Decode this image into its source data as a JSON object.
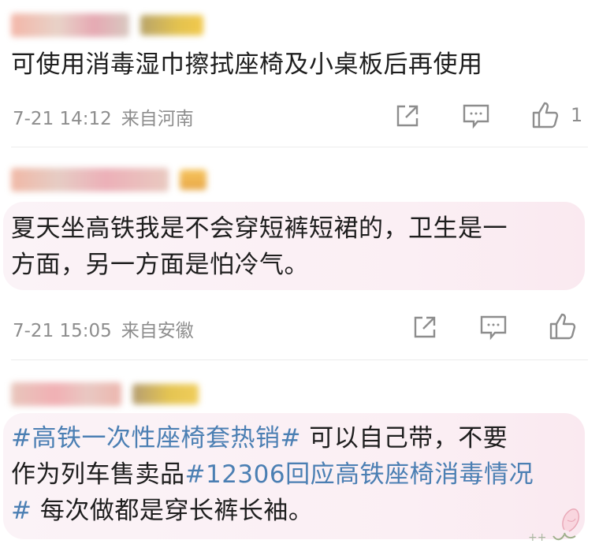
{
  "comments": [
    {
      "text": "可使用消毒湿巾擦拭座椅及小桌板后再使用",
      "date": "7-21 14:12",
      "location": "来自河南",
      "like_count": "1"
    },
    {
      "text_line1": "夏天坐高铁我是不会穿短裤短裙的，卫生是一",
      "text_line2": "方面，另一方面是怕冷气。",
      "date": "7-21 15:05",
      "location": "来自安徽",
      "like_count": ""
    },
    {
      "hashtag1": "#高铁一次性座椅套热销#",
      "line1_rest": " 可以自己带，不要",
      "line2_start": "作为列车售卖品",
      "hashtag2": "#12306回应高铁座椅消毒情况",
      "line3_hash_end": "#",
      "line3_rest": " 每次做都是穿长裤长袖。"
    }
  ],
  "colors": {
    "hashtag": "#4b7fb3",
    "meta": "#8d8d8d",
    "bubble": "#fbeff4"
  },
  "icons": [
    "share-icon",
    "comment-icon",
    "like-icon",
    "flower-icon"
  ]
}
